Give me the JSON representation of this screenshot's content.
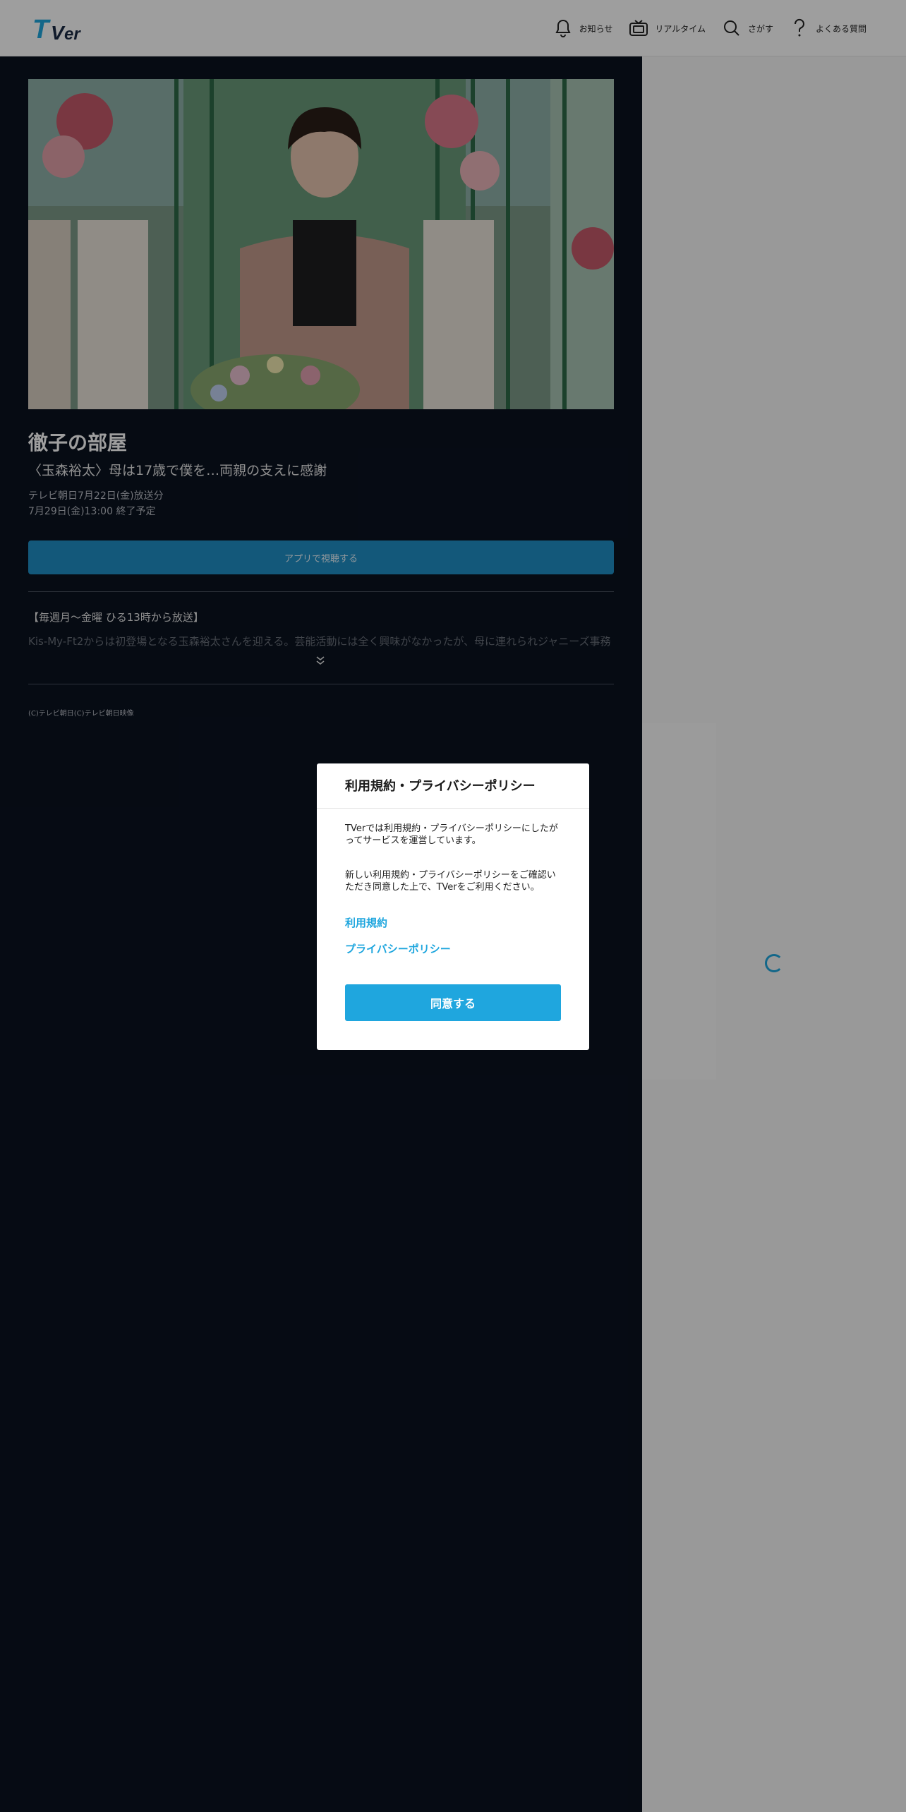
{
  "header": {
    "logo_text": "TVer",
    "nav": [
      {
        "label": "お知らせ",
        "icon": "bell-icon"
      },
      {
        "label": "リアルタイム",
        "icon": "tv-icon"
      },
      {
        "label": "さがす",
        "icon": "search-icon"
      },
      {
        "label": "よくある質問",
        "icon": "question-icon"
      }
    ]
  },
  "episode": {
    "title": "徹子の部屋",
    "subtitle": "〈玉森裕太〉母は17歳で僕を…両親の支えに感謝",
    "broadcast": "テレビ朝日7月22日(金)放送分",
    "end": "7月29日(金)13:00 終了予定",
    "app_button": "アプリで視聴する",
    "desc_line1": "【毎週月～金曜 ひる13時から放送】",
    "desc_line2": "Kis-My-Ft2からは初登場となる玉森裕太さんを迎える。芸能活動には全く興味がなかったが、母に連れられジャニーズ事務",
    "copyright": "(C)テレビ朝日(C)テレビ朝日映像"
  },
  "modal": {
    "title": "利用規約・プライバシーポリシー",
    "p1": "TVerでは利用規約・プライバシーポリシーにしたがってサービスを運営しています。",
    "p2": "新しい利用規約・プライバシーポリシーをご確認いただき同意した上で、TVerをご利用ください。",
    "link_terms": "利用規約",
    "link_privacy": "プライバシーポリシー",
    "agree_button": "同意する"
  },
  "colors": {
    "accent": "#1fa6de",
    "main_bg": "#0a1220"
  }
}
